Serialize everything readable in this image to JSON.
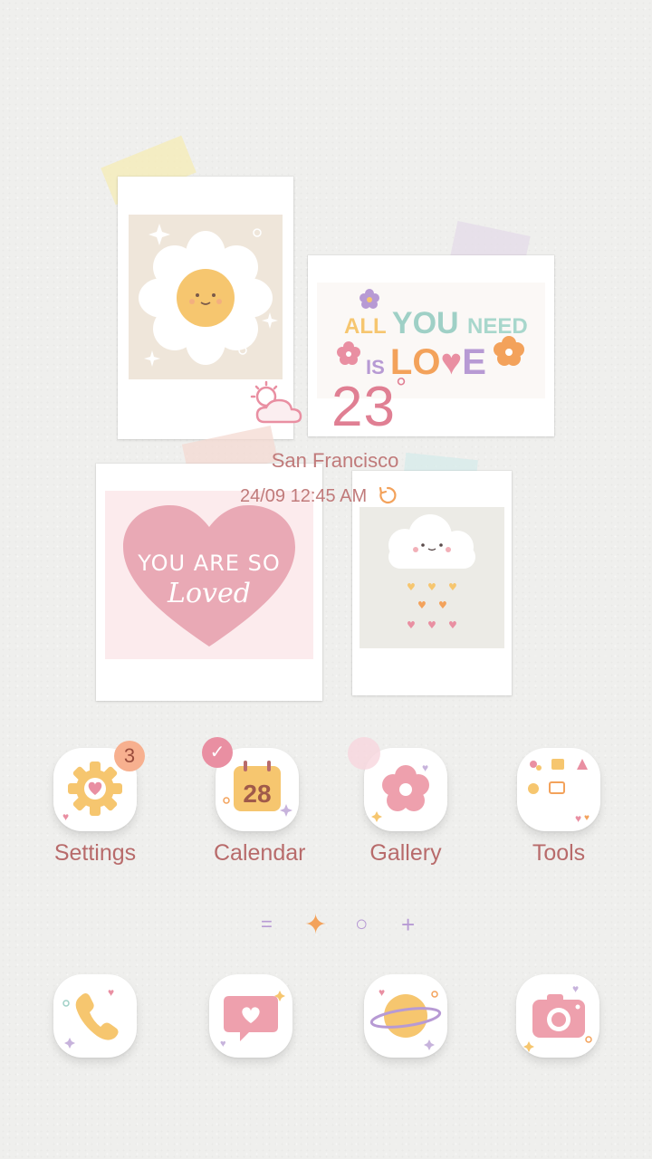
{
  "widgets": {
    "polaroid1_text": "",
    "polaroid2_text_line1": "ALL YOU NEED",
    "polaroid2_text_line2": "IS LOVE",
    "polaroid3_text_line1": "YOU ARE SO",
    "polaroid3_text_line2": "Loved"
  },
  "weather": {
    "temperature": "23",
    "degree_symbol": "°",
    "city": "San Francisco",
    "datetime": "24/09 12:45 AM",
    "icon": "partly-cloudy-icon",
    "refresh_icon": "refresh-icon"
  },
  "apps": [
    {
      "label": "Settings",
      "icon": "gear-heart-icon",
      "badge": "3"
    },
    {
      "label": "Calendar",
      "icon": "calendar-icon",
      "date": "28"
    },
    {
      "label": "Gallery",
      "icon": "flower-icon"
    },
    {
      "label": "Tools",
      "icon": "tools-folder-icon"
    }
  ],
  "pager": {
    "items": [
      "=",
      "✦",
      "○",
      "+"
    ]
  },
  "dock": [
    {
      "icon": "phone-icon"
    },
    {
      "icon": "message-heart-icon"
    },
    {
      "icon": "planet-icon"
    },
    {
      "icon": "camera-icon"
    }
  ],
  "colors": {
    "text_rose": "#b86b6b",
    "temp_pink": "#e07f93",
    "accent_orange": "#f3a25b",
    "accent_pink": "#e98fa2",
    "accent_yellow": "#f6c66f",
    "accent_purple": "#b79ad4"
  }
}
